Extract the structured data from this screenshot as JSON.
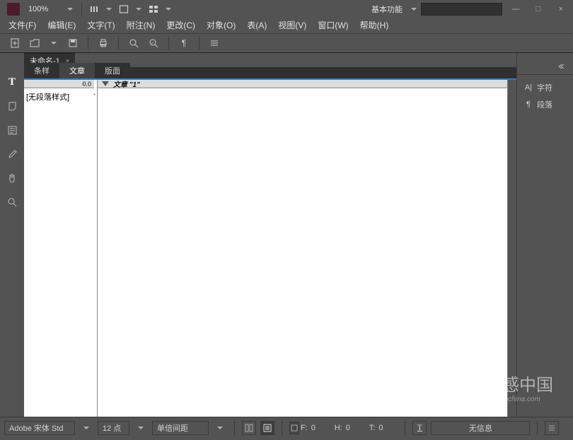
{
  "titlebar": {
    "zoom": "100%"
  },
  "workspace": {
    "label": "基本功能"
  },
  "window_buttons": {
    "min": "—",
    "max": "□",
    "close": "×"
  },
  "menu": [
    "文件(F)",
    "编辑(E)",
    "文字(T)",
    "附注(N)",
    "更改(C)",
    "对象(O)",
    "表(A)",
    "视图(V)",
    "窗口(W)",
    "帮助(H)"
  ],
  "document": {
    "tab_name": "未命名-1",
    "story_tabs": [
      "条样",
      "文章",
      "版面"
    ],
    "active_story_tab": 1,
    "ruler_value": "0.0",
    "paragraph_style": "[无段落样式]",
    "content_header": "文章 \"1\""
  },
  "right_panels": [
    {
      "icon": "A|",
      "label": "字符"
    },
    {
      "icon": "¶",
      "label": "段落"
    }
  ],
  "status": {
    "font": "Adobe 宋体 Std",
    "size": "12 点",
    "leading": "单倍间距",
    "f_label": "F:",
    "f_value": "0",
    "h_label": "H:",
    "h_value": "0",
    "t_label": "T:",
    "t_value": "0",
    "info": "无信息"
  },
  "watermark": {
    "text": "灵感中国",
    "sub": "lingganchina.com"
  }
}
